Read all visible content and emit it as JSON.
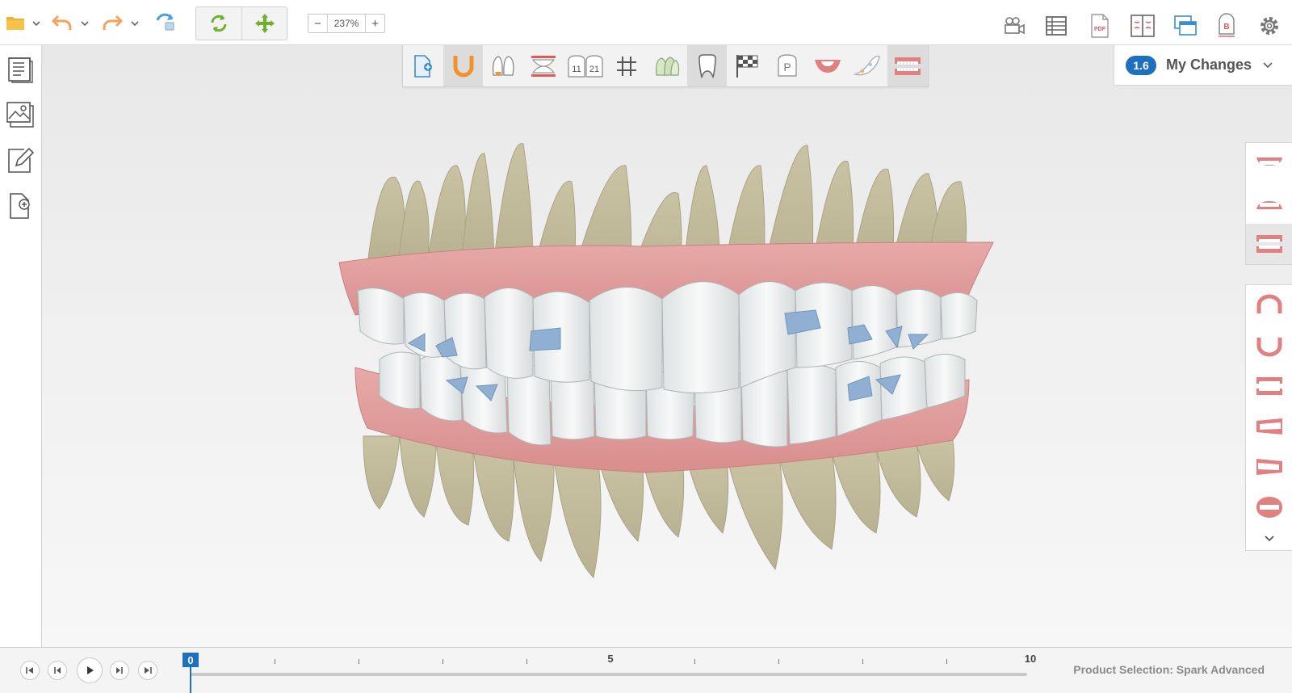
{
  "toolbar": {
    "zoom_value": "237%",
    "zoom_minus": "−",
    "zoom_plus": "+",
    "colors": {
      "accent": "#1f6fbf",
      "orange": "#f4a35a",
      "green": "#6fb02c",
      "icon_gray": "#6b6b6b",
      "red": "#e06a6a"
    }
  },
  "left_sidebar": {
    "items": [
      {
        "icon": "notes-icon"
      },
      {
        "icon": "images-icon"
      },
      {
        "icon": "edit-icon"
      },
      {
        "icon": "add-document-icon"
      }
    ]
  },
  "tool_tray": {
    "tools": [
      {
        "icon": "add-model-icon",
        "active": false
      },
      {
        "icon": "arch-icon",
        "active": true
      },
      {
        "icon": "root-icon",
        "active": false
      },
      {
        "icon": "occlusion-icon",
        "active": false
      },
      {
        "icon": "tooth-numbering-icon",
        "label_a": "11",
        "label_b": "21",
        "active": false
      },
      {
        "icon": "grid-icon",
        "active": false
      },
      {
        "icon": "superimpose-icon",
        "active": false
      },
      {
        "icon": "tooth-icon",
        "active": true
      },
      {
        "icon": "finish-flag-icon",
        "active": false
      },
      {
        "icon": "pontic-icon",
        "label": "P",
        "active": false
      },
      {
        "icon": "gingiva-icon",
        "active": false
      },
      {
        "icon": "cutout-icon",
        "active": false
      },
      {
        "icon": "full-arch-icon",
        "active": true
      }
    ]
  },
  "changes": {
    "version": "1.6",
    "title": "My Changes"
  },
  "right_top_icons": [
    {
      "icon": "video-camera-icon"
    },
    {
      "icon": "table-icon"
    },
    {
      "icon": "pdf-icon",
      "label": "PDF"
    },
    {
      "icon": "split-view-icon"
    },
    {
      "icon": "windows-icon"
    },
    {
      "icon": "bolton-icon",
      "label": "B"
    },
    {
      "icon": "gear-icon"
    }
  ],
  "view_panel": {
    "top_group": [
      {
        "icon": "upper-jaw-view-icon",
        "selected": false
      },
      {
        "icon": "lower-jaw-view-icon",
        "selected": false
      },
      {
        "icon": "both-jaws-view-icon",
        "selected": true
      }
    ],
    "bottom_group": [
      {
        "icon": "upper-occlusal-view-icon"
      },
      {
        "icon": "lower-occlusal-view-icon"
      },
      {
        "icon": "front-view-icon"
      },
      {
        "icon": "right-view-icon"
      },
      {
        "icon": "left-view-icon"
      },
      {
        "icon": "back-view-icon"
      }
    ]
  },
  "timeline": {
    "current_stage": "0",
    "labels": [
      "0",
      "5",
      "10"
    ],
    "max_stage": 10,
    "product_selection": "Product Selection: Spark Advanced"
  }
}
